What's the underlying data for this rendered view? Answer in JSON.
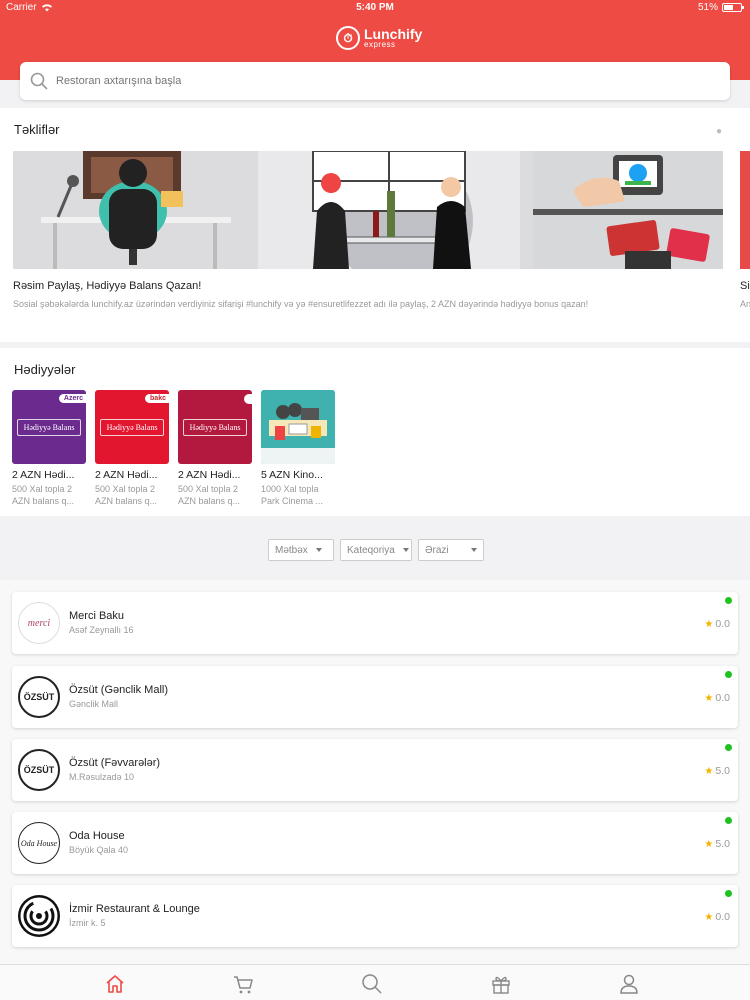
{
  "status_bar": {
    "carrier": "Carrier",
    "time": "5:40 PM",
    "battery": "51%"
  },
  "header": {
    "logo_name": "Lunchify",
    "logo_sub": "express"
  },
  "search": {
    "placeholder": "Restoran axtarışına başla"
  },
  "offers": {
    "title": "Təkliflər",
    "items": [
      {
        "title": "Rəsim Paylaş, Hədiyyə Balans Qazan!",
        "description": "Sosial şəbəkələrda lunchify.az üzərindən verdiyiniz sifarişi #lunchify və yə #ensuretlifezzet adı ilə paylaş, 2 AZN dəyərində hədiyyə bonus qazan!"
      },
      {
        "title": "Si",
        "description": "An"
      }
    ]
  },
  "gifts": {
    "title": "Hədiyyələr",
    "items": [
      {
        "name": "2 AZN Hədi...",
        "sub_1": "500 Xal topla 2",
        "sub_2": "AZN balans q...",
        "card_label": "Hədiyyə Balans",
        "brand": "Azerc",
        "color": "#6b2a8e"
      },
      {
        "name": "2 AZN Hədi...",
        "sub_1": "500 Xal topla 2",
        "sub_2": "AZN balans q...",
        "card_label": "Hədiyyə Balans",
        "brand": "bakc",
        "color": "#e2172f"
      },
      {
        "name": "2 AZN Hədi...",
        "sub_1": "500 Xal topla 2",
        "sub_2": "AZN balans q...",
        "card_label": "Hədiyyə Balans",
        "brand": "",
        "color": "#b3193f"
      },
      {
        "name": "5 AZN Kino...",
        "sub_1": "1000 Xal topla",
        "sub_2": "Park Cinema ...",
        "card_label": "",
        "brand": "",
        "color": "#3fb2b0"
      }
    ]
  },
  "filters": {
    "kitchen": "Mətbəx",
    "category": "Kateqoriya",
    "area": "Ərazi"
  },
  "restaurants": [
    {
      "name": "Merci Baku",
      "address": "Asəf Zeynallı 16",
      "rating": "0.0",
      "logo": "merci"
    },
    {
      "name": "Özsüt (Gənclik Mall)",
      "address": "Gənclik Mall",
      "rating": "0.0",
      "logo": "ozsut"
    },
    {
      "name": "Özsüt (Fəvvarələr)",
      "address": "M.Rəsulzadə 10",
      "rating": "5.0",
      "logo": "ozsut"
    },
    {
      "name": "Oda House",
      "address": "Böyük Qala 40",
      "rating": "5.0",
      "logo": "oda"
    },
    {
      "name": "İzmir Restaurant & Lounge",
      "address": "İzmir k. 5",
      "rating": "0.0",
      "logo": "izmir"
    }
  ],
  "ozsut_logo_text": "ÖZSÜT",
  "merci_logo_text": "merci",
  "oda_logo_text": "Oda House",
  "colors": {
    "brand": "#ee4b45",
    "online": "#1ec31e",
    "star": "#f0b400"
  },
  "tabbar": {
    "icons": [
      "home-icon",
      "cart-icon",
      "search-icon",
      "gift-icon",
      "user-icon"
    ],
    "active": "home-icon"
  }
}
